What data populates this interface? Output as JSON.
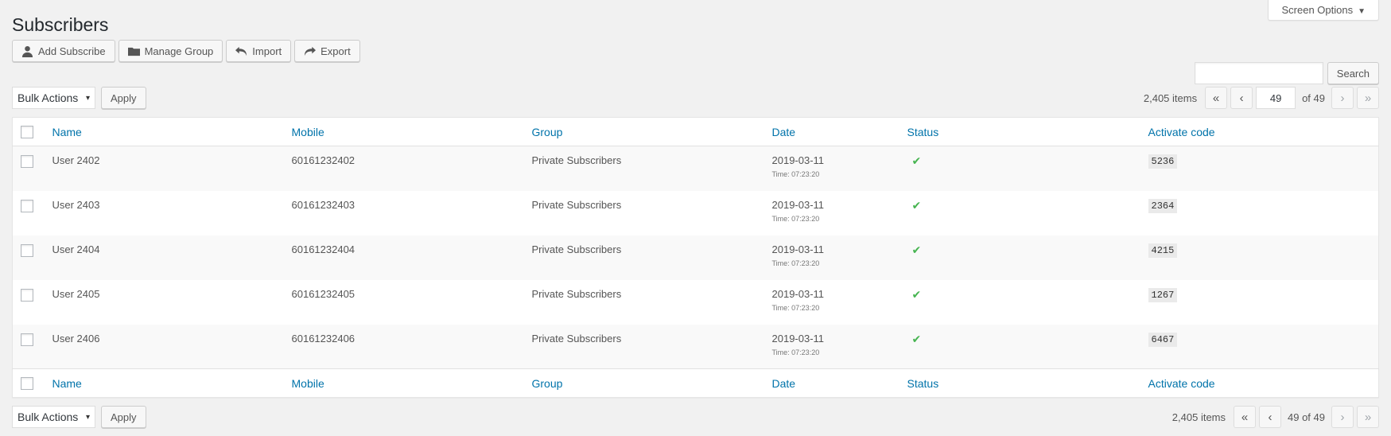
{
  "screen_options": {
    "label": "Screen Options",
    "arrow": "▼"
  },
  "page_title": "Subscribers",
  "toolbar": {
    "add_subscribe": "Add Subscribe",
    "manage_group": "Manage Group",
    "import": "Import",
    "export": "Export"
  },
  "search": {
    "button": "Search",
    "placeholder": ""
  },
  "bulk": {
    "label": "Bulk Actions",
    "caret": "▾",
    "apply": "Apply"
  },
  "pagination_top": {
    "count": "2,405 items",
    "first": "«",
    "prev": "‹",
    "current_page": "49",
    "of": "of 49",
    "next": "›",
    "last": "»"
  },
  "pagination_bottom": {
    "count": "2,405 items",
    "first": "«",
    "prev": "‹",
    "page_text": "49 of 49",
    "next": "›",
    "last": "»"
  },
  "columns": {
    "name": "Name",
    "mobile": "Mobile",
    "group": "Group",
    "date": "Date",
    "status": "Status",
    "code": "Activate code"
  },
  "status_icon": "✔",
  "status_color": "#46b450",
  "link_color": "#0073aa",
  "rows": [
    {
      "name": "User 2402",
      "mobile": "60161232402",
      "group": "Private Subscribers",
      "date": "2019-03-11",
      "time": "Time: 07:23:20",
      "code": "5236"
    },
    {
      "name": "User 2403",
      "mobile": "60161232403",
      "group": "Private Subscribers",
      "date": "2019-03-11",
      "time": "Time: 07:23:20",
      "code": "2364"
    },
    {
      "name": "User 2404",
      "mobile": "60161232404",
      "group": "Private Subscribers",
      "date": "2019-03-11",
      "time": "Time: 07:23:20",
      "code": "4215"
    },
    {
      "name": "User 2405",
      "mobile": "60161232405",
      "group": "Private Subscribers",
      "date": "2019-03-11",
      "time": "Time: 07:23:20",
      "code": "1267"
    },
    {
      "name": "User 2406",
      "mobile": "60161232406",
      "group": "Private Subscribers",
      "date": "2019-03-11",
      "time": "Time: 07:23:20",
      "code": "6467"
    }
  ]
}
